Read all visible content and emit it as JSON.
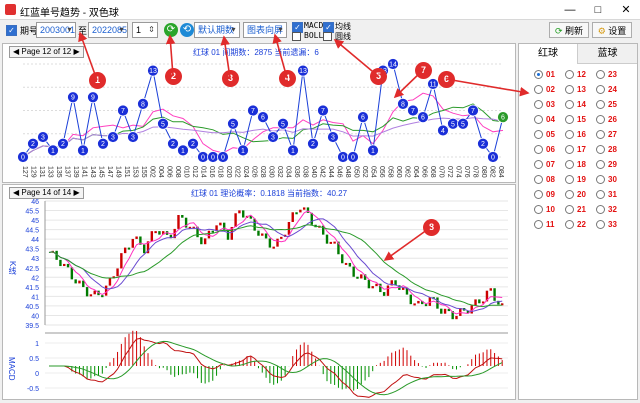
{
  "window": {
    "title": "红蓝单号趋势 - 双色球"
  },
  "toolbar": {
    "period_label": "期号",
    "from_period": "2003001",
    "to_label": "至",
    "to_period": "2022085",
    "step_value": "1",
    "period_mode": "默认期数",
    "direction": "图表向屏",
    "macd_label": "MACD",
    "avg_label": "均线",
    "boll_label": "BOLL",
    "circle_label": "圆线",
    "refresh_label": "刷新",
    "settings_label": "设置"
  },
  "top_chart": {
    "page_label": "Page 12 of 12",
    "info": "红球 01 间期数：2875 当前遗漏：6",
    "x_labels": [
      "127",
      "128",
      "129",
      "130",
      "131",
      "132",
      "133",
      "134",
      "135",
      "136",
      "137",
      "138",
      "139",
      "140",
      "141",
      "142",
      "143",
      "144",
      "145",
      "146",
      "147",
      "148",
      "149",
      "150",
      "151",
      "152",
      "153",
      "154",
      "155",
      "001",
      "002",
      "003",
      "004",
      "005",
      "006",
      "007",
      "008",
      "009",
      "010",
      "011",
      "012",
      "013",
      "014",
      "015",
      "016",
      "017",
      "018",
      "019",
      "020",
      "021",
      "022",
      "023",
      "024",
      "025",
      "026",
      "027",
      "028",
      "029",
      "030",
      "031",
      "032",
      "033",
      "034",
      "035",
      "036",
      "037",
      "038",
      "039",
      "040",
      "041",
      "042",
      "043",
      "044",
      "045",
      "046",
      "047",
      "048",
      "049",
      "050",
      "051",
      "052",
      "053",
      "054",
      "055",
      "056",
      "057",
      "058",
      "059",
      "060",
      "061",
      "062",
      "063",
      "064",
      "065",
      "066",
      "067",
      "068",
      "069",
      "070",
      "071",
      "072",
      "073",
      "074",
      "075",
      "076",
      "077",
      "078",
      "079",
      "080",
      "081",
      "082",
      "083",
      "084",
      "085"
    ],
    "ball_values": [
      0,
      2,
      3,
      1,
      2,
      9,
      1,
      9,
      2,
      3,
      7,
      3,
      8,
      13,
      5,
      2,
      1,
      2,
      0,
      0,
      0,
      5,
      1,
      7,
      6,
      3,
      5,
      1,
      13,
      2,
      7,
      3,
      0,
      0,
      6,
      1,
      13,
      14,
      8,
      7,
      6,
      11,
      4,
      5,
      5,
      7,
      2,
      0,
      6
    ],
    "last_value": "6"
  },
  "bottom_chart": {
    "page_label": "Page 14 of 14",
    "info": "红球 01 理论概率：0.1818 当前指数：40.27",
    "y_labels": [
      "46",
      "45.5",
      "45",
      "44.5",
      "44",
      "43.5",
      "43",
      "42.5",
      "42",
      "41.5",
      "41",
      "40.5",
      "40",
      "39.5"
    ],
    "axis_label": "K线",
    "macd_label": "MACD",
    "macd_y_labels": [
      "1",
      "0.5",
      "0",
      "-0.5"
    ]
  },
  "sidebar": {
    "tabs": [
      "红球",
      "蓝球"
    ],
    "balls": [
      "01",
      "02",
      "03",
      "04",
      "05",
      "06",
      "07",
      "08",
      "09",
      "10",
      "11",
      "12",
      "13",
      "14",
      "15",
      "16",
      "17",
      "18",
      "19",
      "20",
      "21",
      "22",
      "23",
      "24",
      "25",
      "26",
      "27",
      "28",
      "29",
      "30",
      "31",
      "32",
      "33"
    ],
    "selected": "01"
  },
  "annotations": [
    "1",
    "2",
    "3",
    "4",
    "5",
    "6",
    "7",
    "8"
  ],
  "colors": {
    "accent": "#1a3fd8",
    "marker": "#e02b2b",
    "candle_up": "#cc0000",
    "candle_down": "#008000"
  }
}
